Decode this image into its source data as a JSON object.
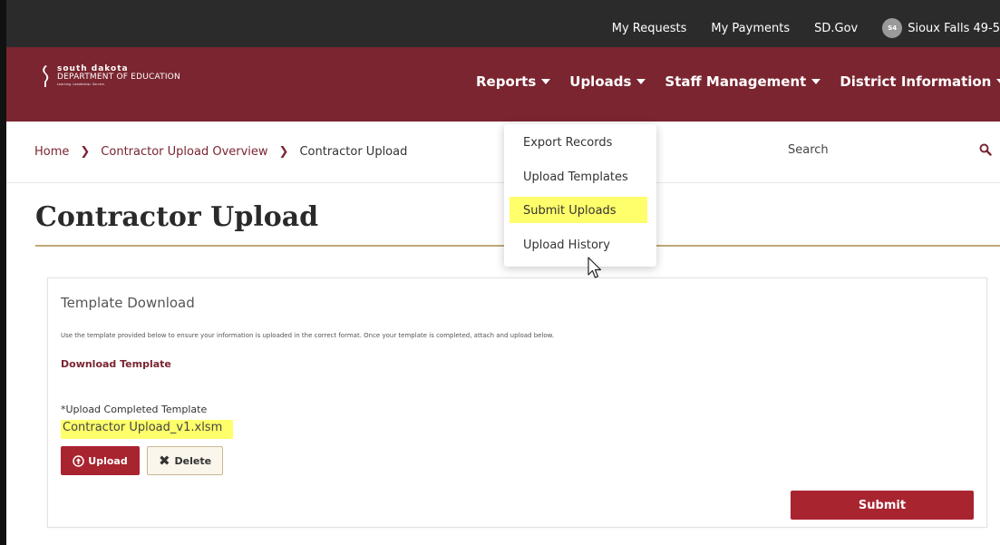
{
  "topbar": {
    "links": [
      "My Requests",
      "My Payments",
      "SD.Gov"
    ],
    "avatar_initials": "S4",
    "org_name": "Sioux Falls 49-5"
  },
  "logo": {
    "line1": "south dakota",
    "line2": "DEPARTMENT OF EDUCATION",
    "tagline": "Learning. Leadership. Service."
  },
  "nav": {
    "items": [
      "Reports",
      "Uploads",
      "Staff Management",
      "District Information"
    ]
  },
  "dropdown": {
    "options": [
      "Export Records",
      "Upload Templates",
      "Submit Uploads",
      "Upload History"
    ],
    "highlighted": "Submit Uploads"
  },
  "breadcrumb": {
    "home": "Home",
    "overview": "Contractor Upload Overview",
    "current": "Contractor Upload"
  },
  "search": {
    "placeholder": "Search"
  },
  "page": {
    "title": "Contractor Upload"
  },
  "template_card": {
    "heading": "Template Download",
    "description": "Use the template provided below to ensure your information is uploaded in the correct format. Once your template is completed, attach and upload below.",
    "download_link": "Download Template",
    "upload_label": "*Upload Completed Template",
    "file_name": "Contractor Upload_v1.xlsm",
    "upload_button": "Upload",
    "delete_button": "Delete",
    "submit_button": "Submit"
  },
  "colors": {
    "brand_maroon": "#7a2530",
    "button_red": "#a8242f",
    "topbar": "#2b2b2b",
    "gold_rule": "#bfa878",
    "highlight": "#ffff6b"
  }
}
